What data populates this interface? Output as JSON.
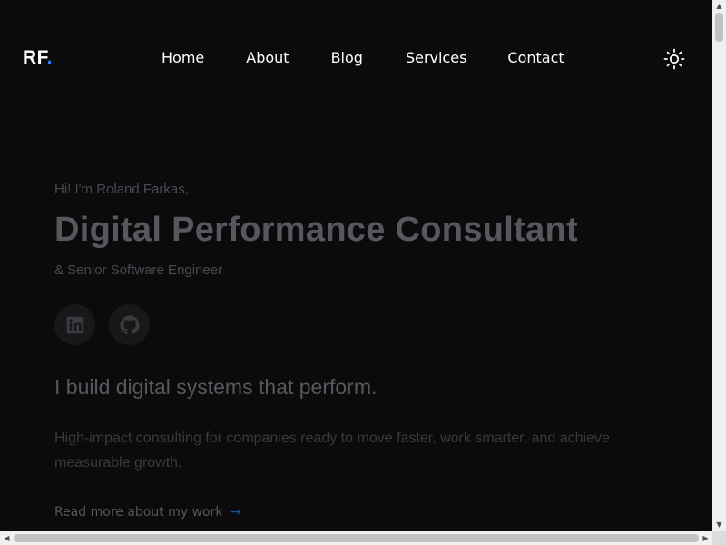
{
  "header": {
    "logo_text": "RF",
    "logo_dot": ".",
    "nav": {
      "home": "Home",
      "about": "About",
      "blog": "Blog",
      "services": "Services",
      "contact": "Contact"
    },
    "theme_icon": "sun-icon"
  },
  "hero": {
    "greeting": "Hi! I'm Roland Farkas,",
    "title": "Digital Performance Consultant",
    "subtitle": "& Senior Software Engineer",
    "socials": [
      {
        "icon": "linkedin-icon"
      },
      {
        "icon": "github-icon"
      }
    ],
    "tagline": "I build digital systems that perform.",
    "description": "High-impact consulting for companies ready to move faster, work smarter, and achieve measurable growth.",
    "read_more": "Read more about my work",
    "read_more_arrow": "→"
  },
  "scrollbars": {
    "vertical_up": "▲",
    "vertical_down": "▼",
    "horizontal_left": "◀",
    "horizontal_right": "▶"
  },
  "colors": {
    "background": "#0b0b0d",
    "accent": "#3b82f6"
  }
}
